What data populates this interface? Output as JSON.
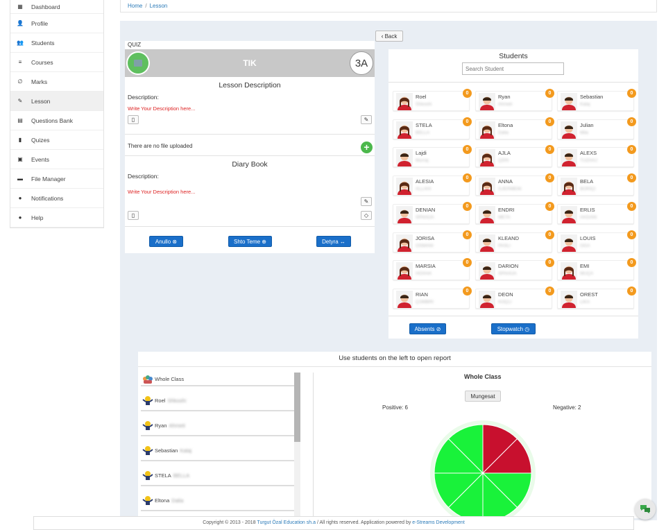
{
  "sidebar": {
    "items": [
      {
        "label": "Dashboard",
        "icon": "dashboard-icon"
      },
      {
        "label": "Profile",
        "icon": "user-icon"
      },
      {
        "label": "Students",
        "icon": "users-icon"
      },
      {
        "label": "Courses",
        "icon": "list-icon"
      },
      {
        "label": "Marks",
        "icon": "paperclip-icon"
      },
      {
        "label": "Lesson",
        "icon": "pencil-icon"
      },
      {
        "label": "Questions Bank",
        "icon": "bank-icon"
      },
      {
        "label": "Quizes",
        "icon": "book-icon"
      },
      {
        "label": "Events",
        "icon": "calendar-icon"
      },
      {
        "label": "File Manager",
        "icon": "folder-icon"
      },
      {
        "label": "Notifications",
        "icon": "bulb-icon"
      },
      {
        "label": "Help",
        "icon": "bulb-icon"
      }
    ]
  },
  "breadcrumb": {
    "home": "Home",
    "sep": "/",
    "current": "Lesson"
  },
  "back_label": "Back",
  "lesson": {
    "quiz_label": "QUIZ",
    "title": "TIK",
    "class_code": "3A",
    "description_title": "Lesson Description",
    "description_label": "Description:",
    "description_placeholder": "Write Your Description here...",
    "no_file": "There are no file uploaded",
    "diary_title": "Diary Book",
    "diary_label": "Description:",
    "diary_placeholder": "Write Your Description here...",
    "buttons": {
      "anullo": "Anullo ⊗",
      "shto_teme": "Shto Teme ⊕",
      "detyra": "Detyra ↔"
    }
  },
  "students_panel": {
    "title": "Students",
    "search_placeholder": "Search Student",
    "students": [
      {
        "first": "Roel",
        "last": "Shkoshi",
        "badge": "0",
        "gender": "f"
      },
      {
        "first": "Ryan",
        "last": "Ahmeti",
        "badge": "0",
        "gender": "m"
      },
      {
        "first": "Sebastian",
        "last": "Kalaj",
        "badge": "0",
        "gender": "m"
      },
      {
        "first": "STELA",
        "last": "BELLA",
        "badge": "0",
        "gender": "f"
      },
      {
        "first": "Eltona",
        "last": "Dalia",
        "badge": "0",
        "gender": "f"
      },
      {
        "first": "Julian",
        "last": "Mila",
        "badge": "0",
        "gender": "m"
      },
      {
        "first": "Lajdi",
        "last": "Murraj",
        "badge": "0",
        "gender": "m"
      },
      {
        "first": "AJLA",
        "last": "ÇERI",
        "badge": "0",
        "gender": "f"
      },
      {
        "first": "ALEXS",
        "last": "TUZHAJ",
        "badge": "0",
        "gender": "m"
      },
      {
        "first": "ALESIA",
        "last": "ALLAHI",
        "badge": "0",
        "gender": "f"
      },
      {
        "first": "ANNA",
        "last": "GJERMENI",
        "badge": "0",
        "gender": "f"
      },
      {
        "first": "BELA",
        "last": "BORIÇI",
        "badge": "0",
        "gender": "f"
      },
      {
        "first": "DENIAN",
        "last": "SPAHIJA",
        "badge": "0",
        "gender": "m"
      },
      {
        "first": "ENDRI",
        "last": "META",
        "badge": "0",
        "gender": "m"
      },
      {
        "first": "ERLIS",
        "last": "HASANI",
        "badge": "0",
        "gender": "m"
      },
      {
        "first": "JORISA",
        "last": "OSMANI",
        "badge": "0",
        "gender": "f"
      },
      {
        "first": "KLEAND",
        "last": "PASLI",
        "badge": "0",
        "gender": "m"
      },
      {
        "first": "LOUIS",
        "last": "OGA",
        "badge": "0",
        "gender": "m"
      },
      {
        "first": "MARSIA",
        "last": "HOXHA",
        "badge": "0",
        "gender": "f"
      },
      {
        "first": "DARION",
        "last": "SPAHIJA",
        "badge": "0",
        "gender": "m"
      },
      {
        "first": "EMI",
        "last": "MUÇA",
        "badge": "0",
        "gender": "f"
      },
      {
        "first": "RIAN",
        "last": "ÇOMBRI",
        "badge": "0",
        "gender": "m"
      },
      {
        "first": "DEON",
        "last": "KOÇLI",
        "badge": "0",
        "gender": "m"
      },
      {
        "first": "OREST",
        "last": "LIKA",
        "badge": "0",
        "gender": "m"
      }
    ],
    "buttons": {
      "absents": "Absents ⊘",
      "stopwatch": "Stopwatch ◷"
    }
  },
  "report": {
    "title": "Use students on the left to open report",
    "list": [
      {
        "first": "Whole Class",
        "last": ""
      },
      {
        "first": "Roel",
        "last": "Shkoshi"
      },
      {
        "first": "Ryan",
        "last": "Ahmeti"
      },
      {
        "first": "Sebastian",
        "last": "Kalaj"
      },
      {
        "first": "STELA",
        "last": "BELLA"
      },
      {
        "first": "Eltona",
        "last": "Dalia"
      }
    ],
    "chart_title": "Whole Class",
    "mungesat": "Mungesat",
    "positive_label": "Positive: 6",
    "negative_label": "Negative: 2"
  },
  "chart_data": {
    "type": "pie",
    "title": "Whole Class",
    "series": [
      {
        "values": [
          1,
          1,
          1,
          1,
          1,
          1,
          1,
          1
        ]
      }
    ],
    "categories": [
      "neg",
      "neg",
      "pos",
      "pos",
      "pos",
      "pos",
      "pos",
      "pos"
    ],
    "colors": {
      "positive": "#19f23a",
      "negative": "#c8102e"
    }
  },
  "footer": {
    "pre": "Copyright © 2013 - 2018 ",
    "company": "Turgut Özal Education sh.a",
    "mid": " / All rights reserved. Application powered by ",
    "dev": "e-Streams Development"
  }
}
